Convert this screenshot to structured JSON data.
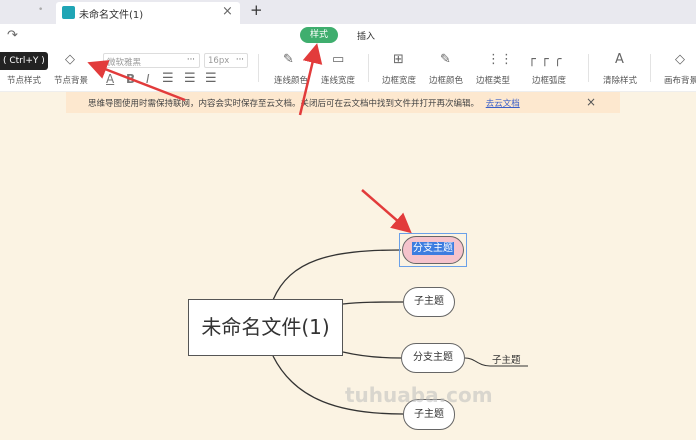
{
  "tabs": {
    "inactive_dot": "•",
    "active_title": "未命名文件(1)",
    "close": "×",
    "new": "+"
  },
  "toolbar": {
    "redo_tooltip": "( Ctrl+Y )",
    "mode_tabs": [
      {
        "label": "样式",
        "active": true
      },
      {
        "label": "插入",
        "active": false
      }
    ],
    "font_family": "微软雅黑",
    "font_size": "16px",
    "more": "···",
    "items": [
      "节点样式",
      "节点背景",
      "连线颜色",
      "连线宽度",
      "边框宽度",
      "边框颜色",
      "边框类型",
      "边框弧度",
      "清除样式",
      "画布背景"
    ],
    "format_buttons": [
      "A",
      "B",
      "I"
    ]
  },
  "notice": {
    "text": "思维导图使用时需保持联网，内容会实时保存至云文档。关闭后可在云文档中找到文件并打开再次编辑。",
    "link": "去云文档",
    "close": "×"
  },
  "mindmap": {
    "root": "未命名文件(1)",
    "branches": [
      {
        "label": "分支主题",
        "selected": true
      },
      {
        "label": "子主题"
      },
      {
        "label": "分支主题",
        "children": [
          "子主题"
        ]
      },
      {
        "label": "子主题"
      }
    ]
  },
  "watermark": "tuhuaba.com",
  "colors": {
    "accent": "#3fae6e",
    "arrow": "#e23b3b",
    "selection": "#3d7de0"
  }
}
